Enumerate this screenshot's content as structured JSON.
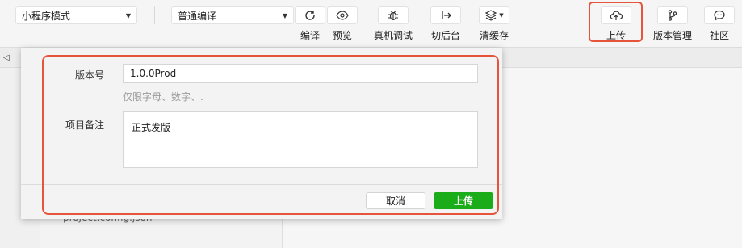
{
  "toolbar": {
    "mode_select": "小程序模式",
    "compile_select": "普通编译",
    "tools": {
      "compile": "编译",
      "preview": "预览",
      "remote_debug": "真机调试",
      "background": "切后台",
      "clear_cache": "清缓存",
      "upload": "上传",
      "version_mgmt": "版本管理",
      "community": "社区"
    }
  },
  "file_peek": "project.config.json",
  "dialog": {
    "version_label": "版本号",
    "version_value": "1.0.0Prod",
    "version_hint": "仅限字母、数字、.",
    "note_label": "项目备注",
    "note_value": "正式发版",
    "cancel_label": "取消",
    "upload_label": "上传"
  },
  "colors": {
    "primary_button": "#1aad19",
    "highlight": "#e5543b"
  }
}
